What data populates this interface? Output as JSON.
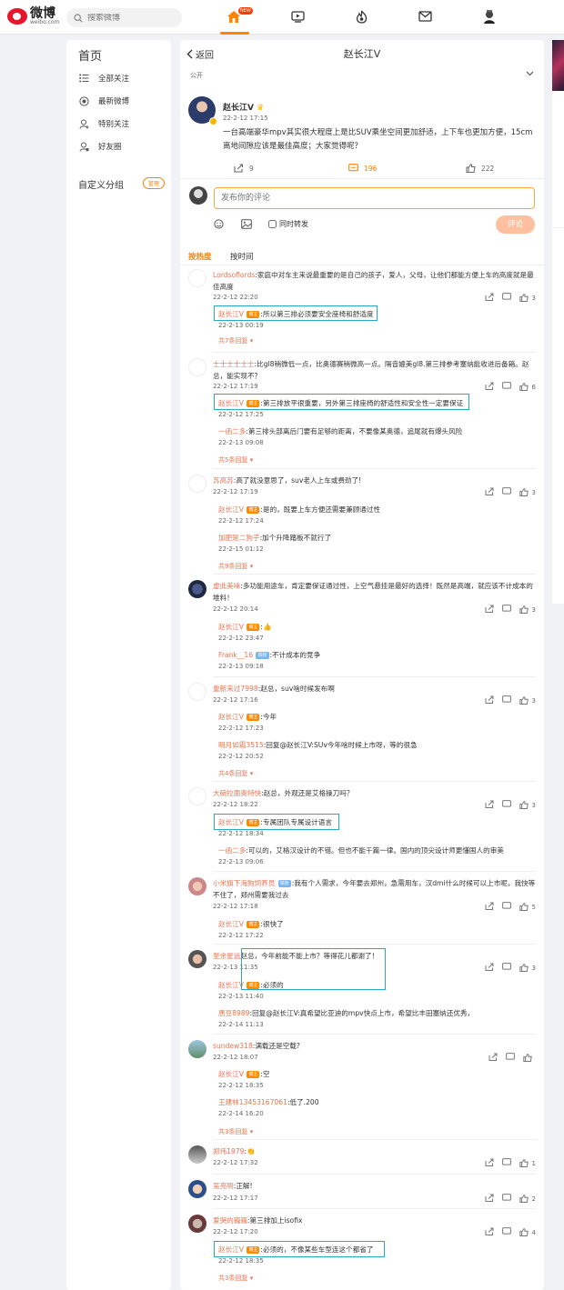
{
  "header": {
    "logo_cn": "微博",
    "logo_en": "weibo.com",
    "search_placeholder": "搜索微博",
    "new_badge": "NEW",
    "accent": "#ff8200",
    "brand": "#e6162d"
  },
  "sidebar": {
    "title": "首页",
    "items": [
      {
        "label": "全部关注",
        "icon": "list-icon"
      },
      {
        "label": "最新微博",
        "icon": "clock-icon"
      },
      {
        "label": "特别关注",
        "icon": "star-user-icon"
      },
      {
        "label": "好友圈",
        "icon": "friends-icon"
      }
    ],
    "custom_group_title": "自定义分组",
    "manage_label": "管理"
  },
  "detail": {
    "back_label": "返回",
    "title": "赵长江V",
    "visibility": "公开"
  },
  "post": {
    "author": "赵长江V",
    "time": "22-2-12 17:15",
    "text": "一台高端豪华mpv其实很大程度上是比SUV乘坐空间更加舒适，上下车也更加方便，15cm离地间隙应该是最佳高度；大家觉得呢？",
    "reposts": "9",
    "comments": "196",
    "likes": "222"
  },
  "composer": {
    "placeholder": "发布你的评论",
    "repost_label": "同时转发",
    "submit_label": "评论"
  },
  "sort": {
    "hot": "按热度",
    "time": "按时间"
  },
  "comments": [
    {
      "user": "Lordsoflords",
      "text": ":家庭中对车主来说最重要的是自己的孩子，爱人，父母，让他们都能方便上车的高度就是最佳高度",
      "time": "22-2-12 22:20",
      "likes": "3",
      "replies": [
        {
          "user": "赵长江V",
          "text": ":所以第三排必须要安全座椅和舒适度",
          "time": "22-2-13 00:19"
        }
      ],
      "more": "共7条回复"
    },
    {
      "user": "士士士士士士",
      "text": ":比gl8稍微低一点，比奥德赛稍微高一点。隔音媲美gl8.第三排参考塞纳能收进后备箱。赵总，能实现不？",
      "time": "22-2-12 17:19",
      "likes": "6",
      "replies": [
        {
          "user": "赵长江V",
          "text": ":第三排放平很重要，另外第三排座椅的舒适性和安全性一定要保证",
          "time": "22-2-12 17:25"
        },
        {
          "user": "一函二多",
          "text": ":第三排头部离后门要有足够的距离，不要像某奥德，追尾就有爆头风险",
          "time": "22-2-13 09:08"
        }
      ],
      "more": "共5条回复"
    },
    {
      "user": "苏高苏",
      "text": ":高了就没意思了，suv老人上车或费劲了!",
      "time": "22-2-12 17:19",
      "likes": "3",
      "replies": [
        {
          "user": "赵长江V",
          "text": ":是的，既要上车方便还需要兼顾通过性",
          "time": "22-2-12 17:24"
        },
        {
          "user": "加肥是二狗子",
          "text": ":加个升降踏板不就行了",
          "time": "22-2-15 01:12"
        }
      ],
      "more": "共9条回复"
    },
    {
      "user": "虚此美味",
      "text": ":多功能用途车，肯定要保证通过性，上空气悬挂是最好的选择！既然是高端，就应该不计成本的堆料！",
      "time": "22-2-12 20:14",
      "likes": "3",
      "replies": [
        {
          "user": "赵长江V",
          "text": ":👍",
          "time": "22-2-12 23:47"
        },
        {
          "user": "Frank__16",
          "text": ":不计成本的竞争",
          "time": "22-2-13 09:18"
        }
      ],
      "more": ""
    },
    {
      "user": "重新来过7998",
      "text": ":赵总，suv啥时候发布啊",
      "time": "22-2-12 17:16",
      "likes": "3",
      "replies": [
        {
          "user": "赵长江V",
          "text": ":今年",
          "time": "22-2-12 17:23"
        },
        {
          "user": "明月如霜3515",
          "text": ":回复@赵长江V:SUv今年啥时候上市呀，等的很急",
          "time": "22-2-12 20:52"
        }
      ],
      "more": "共4条回复"
    },
    {
      "user": "大碗拉面奥特快",
      "text": ":赵总，外观还是艾格操刀吗？",
      "time": "22-2-12 18:22",
      "likes": "3",
      "replies": [
        {
          "user": "赵长江V",
          "text": ":专属团队专属设计语言",
          "time": "22-2-12 18:34"
        },
        {
          "user": "一函二多",
          "text": ":可以的，艾格汉设计的不错。但也不能千篇一律。国内的顶尖设计师更懂国人的审美",
          "time": "22-2-13 09:06"
        }
      ],
      "more": ""
    },
    {
      "user": "小米旗下海狗饲养员",
      "text": ":我有个人需求，今年要去郑州，急需用车，汉dmi什么时候可以上市呢，我快等不住了，郑州需要我过去",
      "time": "22-2-12 17:18",
      "likes": "5",
      "replies": [
        {
          "user": "赵长江V",
          "text": ":很快了",
          "time": "22-2-12 17:22"
        }
      ],
      "more": ""
    },
    {
      "user": "至余星远",
      "text": "赵总，今年前能不能上市？等得花儿都谢了！",
      "time": "22-2-13 11:35",
      "likes": "3",
      "replies": [
        {
          "user": "赵长江V",
          "text": ":必须的",
          "time": "22-2-13 11:40"
        },
        {
          "user": "唐豆8989",
          "text": ":回复@赵长江V:真希望比亚迪的mpv快点上市，希望比丰田塞纳还优秀，",
          "time": "22-2-14 11:13"
        }
      ],
      "more": ""
    },
    {
      "user": "sundew318",
      "text": ":满载还是空载?",
      "time": "22-2-12 18:07",
      "likes": "",
      "replies": [
        {
          "user": "赵长江V",
          "text": ":空",
          "time": "22-2-12 18:35"
        },
        {
          "user": "王建林13453167061",
          "text": ":低了.200",
          "time": "22-2-14 16:20"
        }
      ],
      "more": "共3条回复"
    },
    {
      "user": "郑伟1979",
      "text": ":👏",
      "time": "22-2-12 17:32",
      "likes": "1",
      "replies": [],
      "more": ""
    },
    {
      "user": "吴亮明",
      "text": ":正解!",
      "time": "22-2-12 17:17",
      "likes": "2",
      "replies": [],
      "more": ""
    },
    {
      "user": "爱哭的巍巍",
      "text": ":第三排加上isofix",
      "time": "22-2-12 17:20",
      "likes": "4",
      "replies": [
        {
          "user": "赵长江V",
          "text": ":必须的，不像某些车型连这个都省了",
          "time": "22-2-12 18:35"
        }
      ],
      "more": "共3条回复"
    }
  ]
}
